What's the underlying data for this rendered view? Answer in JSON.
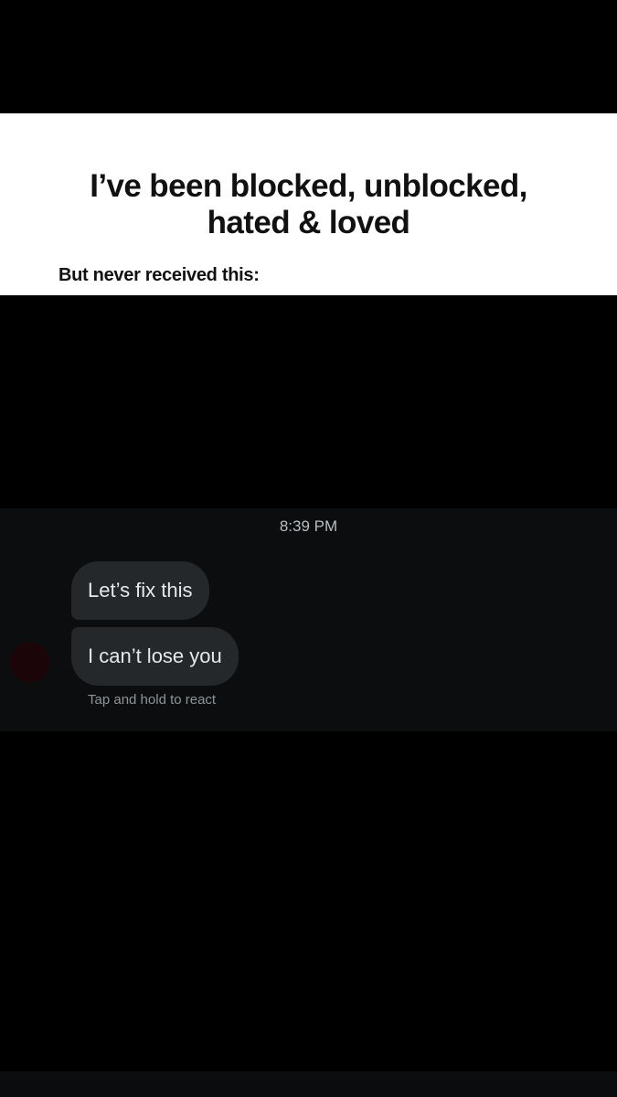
{
  "caption": {
    "headline_line1": "I’ve been blocked, unblocked,",
    "headline_line2": "hated & loved",
    "subline": "But never received this:"
  },
  "chat": {
    "timestamp": "8:39 PM",
    "messages": [
      {
        "text": "Let’s fix this"
      },
      {
        "text": "I can’t lose you"
      }
    ],
    "react_hint": "Tap and hold to react"
  },
  "colors": {
    "background": "#000000",
    "caption_card": "#ffffff",
    "chat_panel": "#0b0d0e",
    "bubble": "#25282b",
    "bubble_text": "#e6e8ea",
    "meta_text": "#8f9498"
  }
}
